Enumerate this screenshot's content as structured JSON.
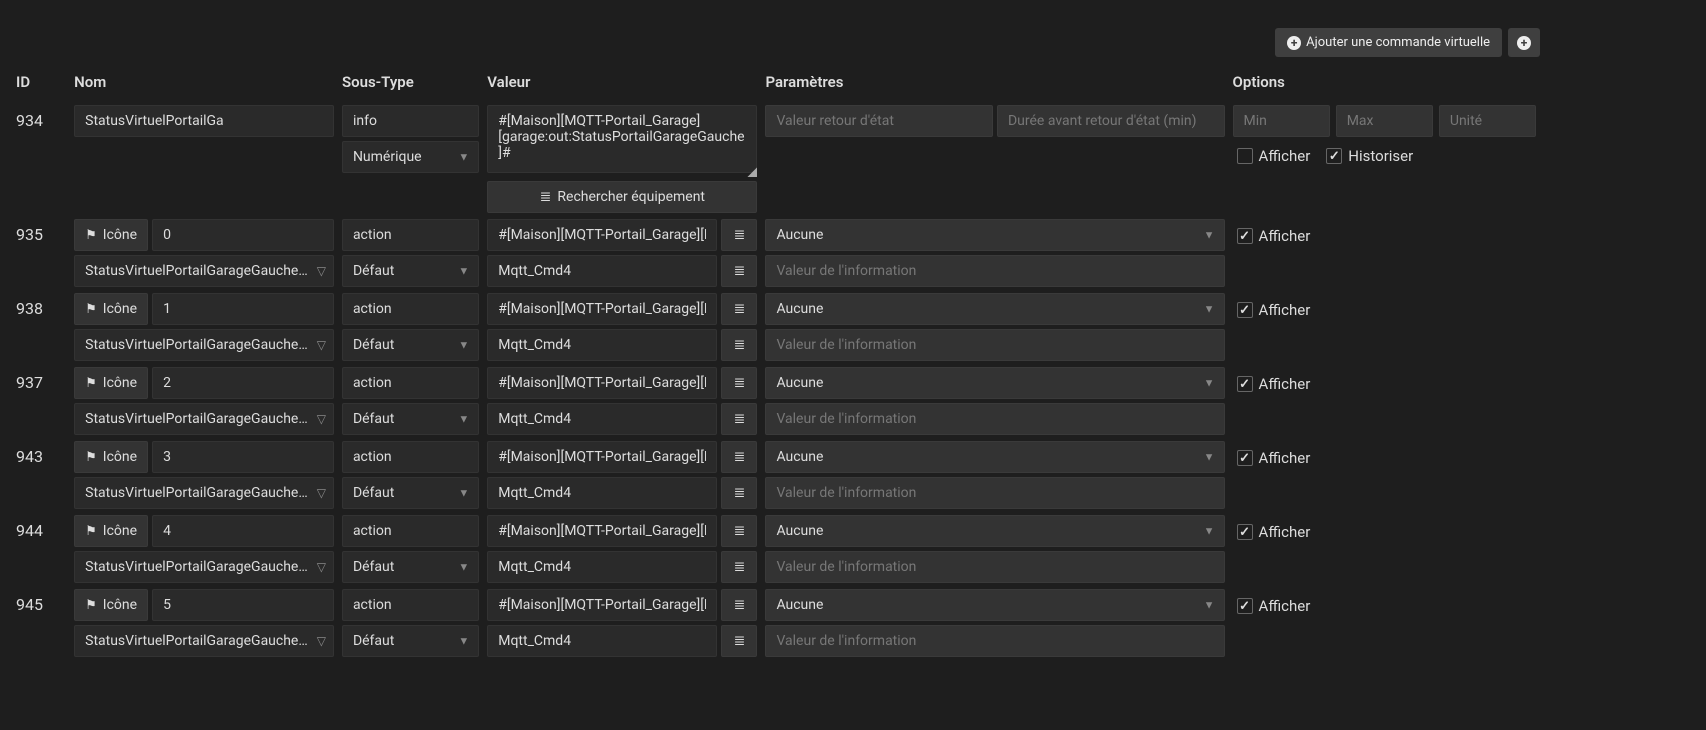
{
  "topbar": {
    "add_virtual_cmd": "Ajouter une commande virtuelle"
  },
  "headers": {
    "id": "ID",
    "nom": "Nom",
    "soustype": "Sous-Type",
    "valeur": "Valeur",
    "parametres": "Paramètres",
    "options": "Options"
  },
  "labels": {
    "icon": "Icône",
    "search_eq": "Rechercher équipement",
    "afficher": "Afficher",
    "historiser": "Historiser"
  },
  "placeholders": {
    "val_retour": "Valeur retour d'état",
    "duree_retour": "Durée avant retour d'état (min)",
    "min": "Min",
    "max": "Max",
    "unite": "Unité",
    "val_info": "Valeur de l'information"
  },
  "infoRow": {
    "id": "934",
    "name": "StatusVirtuelPortailGa",
    "type": "info",
    "subtype": "Numérique",
    "value": "#[Maison][MQTT-Portail_Garage][garage:out:StatusPortailGarageGauche]#"
  },
  "actionRows": [
    {
      "id": "935",
      "icon_value": "0",
      "link": "StatusVirtuelPortailGarageGauche…",
      "type": "action",
      "subtype": "Défaut",
      "val1": "#[Maison][MQTT-Portail_Garage][M",
      "val2": "Mqtt_Cmd4",
      "param_sel": "Aucune"
    },
    {
      "id": "938",
      "icon_value": "1",
      "link": "StatusVirtuelPortailGarageGauche…",
      "type": "action",
      "subtype": "Défaut",
      "val1": "#[Maison][MQTT-Portail_Garage][M",
      "val2": "Mqtt_Cmd4",
      "param_sel": "Aucune"
    },
    {
      "id": "937",
      "icon_value": "2",
      "link": "StatusVirtuelPortailGarageGauche…",
      "type": "action",
      "subtype": "Défaut",
      "val1": "#[Maison][MQTT-Portail_Garage][M",
      "val2": "Mqtt_Cmd4",
      "param_sel": "Aucune"
    },
    {
      "id": "943",
      "icon_value": "3",
      "link": "StatusVirtuelPortailGarageGauche…",
      "type": "action",
      "subtype": "Défaut",
      "val1": "#[Maison][MQTT-Portail_Garage][M",
      "val2": "Mqtt_Cmd4",
      "param_sel": "Aucune"
    },
    {
      "id": "944",
      "icon_value": "4",
      "link": "StatusVirtuelPortailGarageGauche…",
      "type": "action",
      "subtype": "Défaut",
      "val1": "#[Maison][MQTT-Portail_Garage][M",
      "val2": "Mqtt_Cmd4",
      "param_sel": "Aucune"
    },
    {
      "id": "945",
      "icon_value": "5",
      "link": "StatusVirtuelPortailGarageGauche…",
      "type": "action",
      "subtype": "Défaut",
      "val1": "#[Maison][MQTT-Portail_Garage][M",
      "val2": "Mqtt_Cmd4",
      "param_sel": "Aucune"
    }
  ]
}
